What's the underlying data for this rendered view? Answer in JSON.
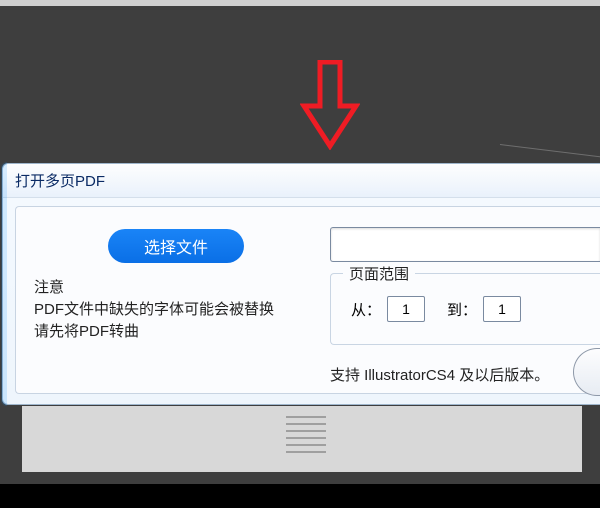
{
  "dialog": {
    "title": "打开多页PDF",
    "choose_file_label": "选择文件",
    "file_path_value": "",
    "notice_title": "注意",
    "notice_line1": "PDF文件中缺失的字体可能会被替换",
    "notice_line2": "请先将PDF转曲",
    "page_range_legend": "页面范围",
    "from_label": "从：",
    "to_label": "到：",
    "from_value": "1",
    "to_value": "1",
    "support_text": "支持 IllustratorCS4 及以后版本。"
  }
}
